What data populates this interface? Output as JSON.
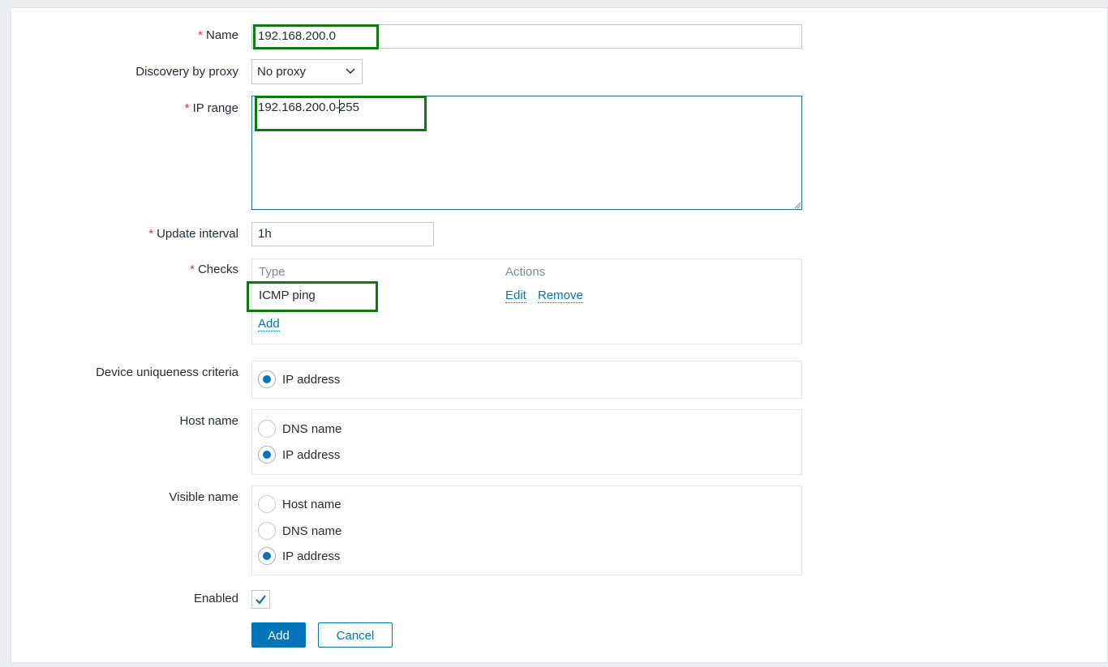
{
  "form": {
    "name": {
      "label": "Name",
      "value": "192.168.200.0"
    },
    "proxy": {
      "label": "Discovery by proxy",
      "selected": "No proxy"
    },
    "ip_range": {
      "label": "IP range",
      "value_before_caret": "192.168.200.0-",
      "value_after_caret": "255"
    },
    "update_interval": {
      "label": "Update interval",
      "value": "1h"
    },
    "checks": {
      "label": "Checks",
      "col_type": "Type",
      "col_actions": "Actions",
      "rows": [
        {
          "type": "ICMP ping",
          "edit": "Edit",
          "remove": "Remove"
        }
      ],
      "add_link": "Add"
    },
    "uniqueness": {
      "label": "Device uniqueness criteria",
      "options": [
        {
          "label": "IP address",
          "checked": true
        }
      ]
    },
    "host_name": {
      "label": "Host name",
      "options": [
        {
          "label": "DNS name",
          "checked": false
        },
        {
          "label": "IP address",
          "checked": true
        }
      ]
    },
    "visible_name": {
      "label": "Visible name",
      "options": [
        {
          "label": "Host name",
          "checked": false
        },
        {
          "label": "DNS name",
          "checked": false
        },
        {
          "label": "IP address",
          "checked": true
        }
      ]
    },
    "enabled": {
      "label": "Enabled",
      "checked": true
    },
    "required_mark": "*"
  },
  "buttons": {
    "add": "Add",
    "cancel": "Cancel"
  },
  "colors": {
    "accent": "#0275b8",
    "highlight": "#0e7a0e",
    "required": "#e33734"
  }
}
